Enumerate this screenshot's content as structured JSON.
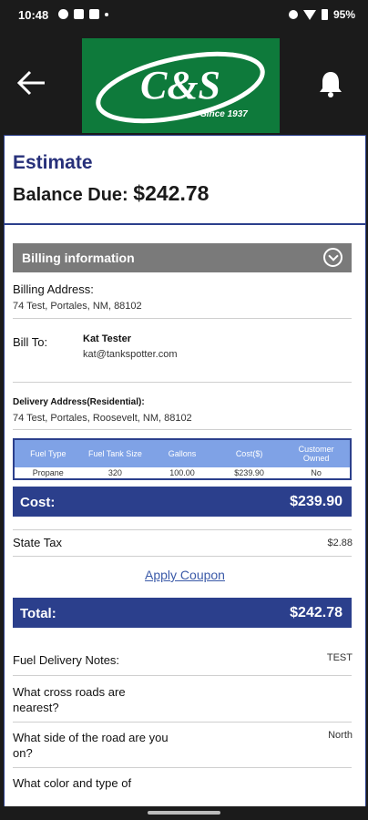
{
  "status": {
    "time": "10:48",
    "battery": "95%"
  },
  "header": {
    "logo_text": "C&S",
    "logo_tagline": "Since 1937"
  },
  "estimate": {
    "title": "Estimate",
    "balance_label": "Balance Due:",
    "balance_value": "$242.78"
  },
  "billing": {
    "section_label": "Billing information",
    "billing_address_label": "Billing Address:",
    "billing_address_value": "74 Test, Portales, NM, 88102",
    "bill_to_label": "Bill To:",
    "bill_to_name": "Kat Tester",
    "bill_to_email": "kat@tankspotter.com",
    "delivery_address_label": "Delivery Address(Residential):",
    "delivery_address_value": "74 Test, Portales, Roosevelt, NM, 88102"
  },
  "fuel_table": {
    "headers": [
      "Fuel Type",
      "Fuel Tank Size",
      "Gallons",
      "Cost($)",
      "Customer Owned"
    ],
    "rows": [
      [
        "Propane",
        "320",
        "100.00",
        "$239.90",
        "No"
      ]
    ]
  },
  "totals": {
    "cost_label": "Cost:",
    "cost_value": "$239.90",
    "state_tax_label": "State Tax",
    "state_tax_value": "$2.88",
    "apply_coupon": "Apply Coupon",
    "total_label": "Total:",
    "total_value": "$242.78"
  },
  "notes": {
    "fuel_delivery_notes_label": "Fuel Delivery Notes:",
    "fuel_delivery_notes_value": "TEST",
    "cross_roads_label": "What cross roads are nearest?",
    "cross_roads_value": "",
    "road_side_label": "What side of the road are you on?",
    "road_side_value": "North",
    "color_type_label": "What color and type of"
  },
  "colors": {
    "navy": "#2b3f8c",
    "logo_green": "#0e7a3b",
    "table_header": "#7fa2e6",
    "billing_bar": "#7a7a7a"
  }
}
